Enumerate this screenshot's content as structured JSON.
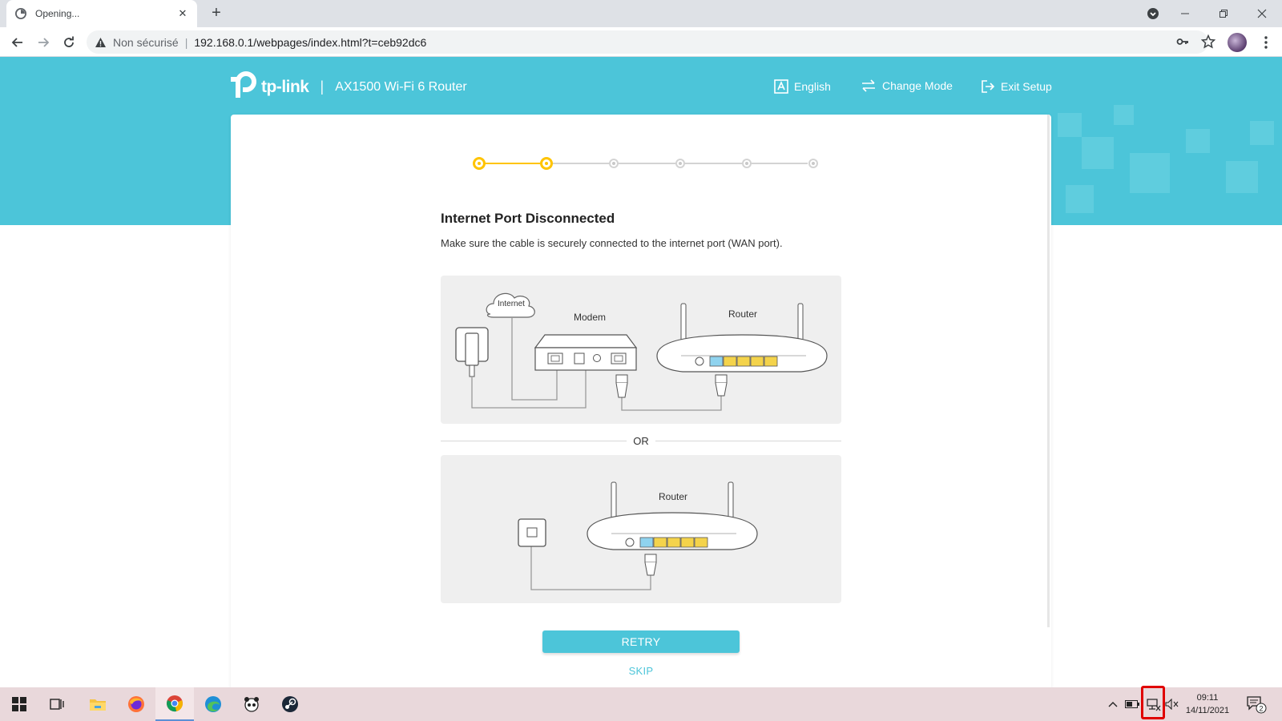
{
  "browser": {
    "tab_title": "Opening...",
    "insecure_label": "Non sécurisé",
    "url": "192.168.0.1/webpages/index.html?t=ceb92dc6"
  },
  "header": {
    "logo_text": "tp-link",
    "divider": "|",
    "model": "AX1500 Wi-Fi 6 Router",
    "nav": {
      "language": "English",
      "change_mode": "Change Mode",
      "exit_setup": "Exit Setup"
    }
  },
  "stepper": {
    "total_steps": 6,
    "completed_steps": 2
  },
  "main": {
    "title": "Internet Port Disconnected",
    "description": "Make sure the cable is securely connected to the internet port (WAN port).",
    "diagram1": {
      "internet_label": "Internet",
      "modem_label": "Modem",
      "router_label": "Router"
    },
    "or_label": "OR",
    "diagram2": {
      "router_label": "Router"
    },
    "retry_label": "RETRY",
    "skip_label": "SKIP"
  },
  "taskbar": {
    "time": "09:11",
    "date": "14/11/2021",
    "notification_count": "2"
  },
  "colors": {
    "brand": "#4cc5d9",
    "step_active": "#ffc400",
    "lan_port": "#f4d34b",
    "wan_port": "#8fd3ef"
  }
}
